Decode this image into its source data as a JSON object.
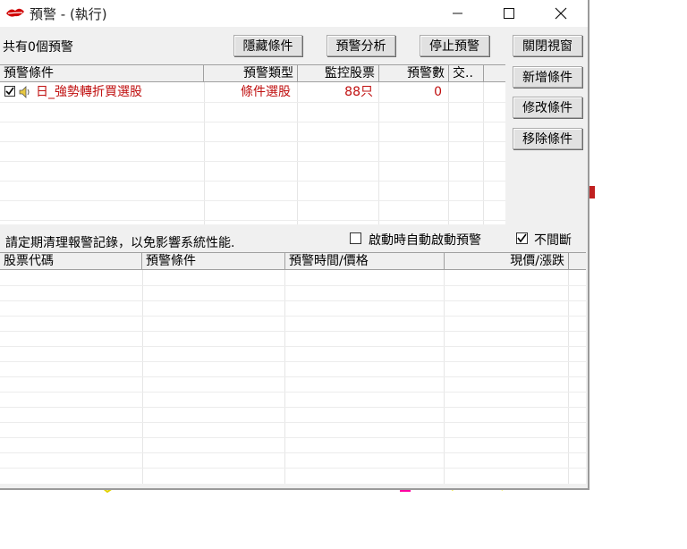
{
  "window": {
    "title": "預警 - (執行)",
    "minimize_icon": "minimize-icon",
    "maximize_icon": "maximize-icon",
    "close_icon": "close-icon"
  },
  "summary": "共有0個預警",
  "buttons": {
    "hide_conditions": "隱藏條件",
    "alert_analysis": "預警分析",
    "stop_alert": "停止預警",
    "close_window": "關閉視窗",
    "add_condition": "新增條件",
    "edit_condition": "修改條件",
    "remove_condition": "移除條件"
  },
  "alert_table": {
    "columns": [
      "預警條件",
      "預警類型",
      "監控股票",
      "預警數",
      "交.."
    ],
    "rows": [
      {
        "checked": true,
        "sound_icon": "speaker-icon",
        "condition": "日_強勢轉折買選股",
        "type": "條件選股",
        "stocks": "88只",
        "count": "0",
        "trade": ""
      }
    ]
  },
  "notice": "請定期清理報警記錄，以免影響系統性能.",
  "options": {
    "auto_start_label": "啟動時自動啟動預警",
    "auto_start_checked": false,
    "continuous_label": "不間斷",
    "continuous_checked": true
  },
  "log_table": {
    "columns": [
      "股票代碼",
      "預警條件",
      "預警時間/價格",
      "現價/漲跌"
    ],
    "rows": []
  },
  "colors": {
    "alert_text": "#c01010",
    "grid_line": "#e6e6e6",
    "header_bg": "#f0f0f0"
  }
}
